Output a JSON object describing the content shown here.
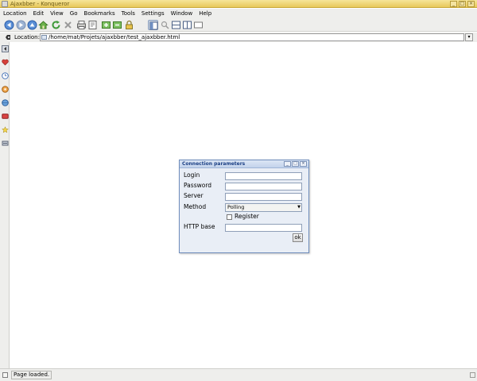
{
  "window": {
    "title": "Ajaxbber - Konqueror"
  },
  "menubar": {
    "items": [
      "Location",
      "Edit",
      "View",
      "Go",
      "Bookmarks",
      "Tools",
      "Settings",
      "Window",
      "Help"
    ]
  },
  "location_bar": {
    "label": "Location:",
    "url": "/home/mat/Projets/ajaxbber/test_ajaxbber.html"
  },
  "dialog": {
    "title": "Connection parameters",
    "fields": {
      "login_label": "Login",
      "login_value": "",
      "password_label": "Password",
      "password_value": "",
      "server_label": "Server",
      "server_value": "",
      "method_label": "Method",
      "method_value": "Polling",
      "register_label": "Register",
      "register_checked": false,
      "httpbase_label": "HTTP base",
      "httpbase_value": ""
    },
    "ok_label": "ok"
  },
  "status": {
    "text": "Page loaded."
  },
  "toolbar": {
    "icons": [
      "back-icon",
      "forward-icon",
      "up-icon",
      "home-icon",
      "reload-icon",
      "stop-icon",
      "print-icon",
      "print-frame-icon",
      "zoom-in-icon",
      "zoom-out-icon",
      "lock-icon",
      "view-tree-icon",
      "search-icon",
      "split-horizontal-icon",
      "split-vertical-icon",
      "remove-view-icon"
    ]
  },
  "sidebar": {
    "icons": [
      "sidebar-toggle-icon",
      "bookmarks-icon",
      "history-icon",
      "media-player-icon",
      "network-icon",
      "services-icon",
      "favorites-icon",
      "storage-icon"
    ]
  },
  "colors": {
    "titlebar": "#e8c85a",
    "dialog_title_text": "#1b3f84",
    "dialog_background": "#e9eef6"
  }
}
